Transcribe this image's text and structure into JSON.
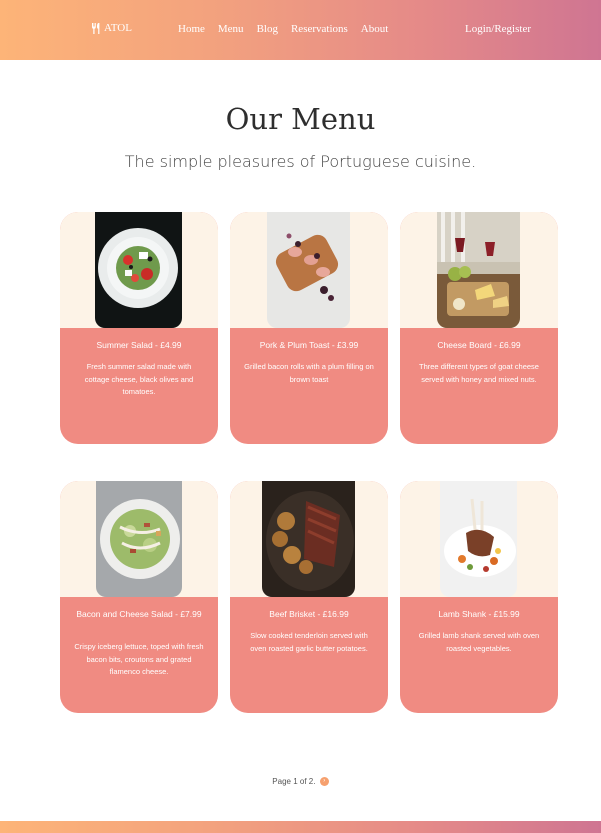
{
  "header": {
    "logo_text": "ATOL",
    "nav": [
      {
        "label": "Home"
      },
      {
        "label": "Menu"
      },
      {
        "label": "Blog"
      },
      {
        "label": "Reservations"
      },
      {
        "label": "About"
      }
    ],
    "login_label": "Login/Register"
  },
  "main": {
    "title": "Our Menu",
    "subtitle": "The simple pleasures of Portuguese cuisine."
  },
  "menu_items": [
    {
      "name": "Summer Salad - £4.99",
      "description": "Fresh summer salad made with cottage cheese, black olives and tomatoes."
    },
    {
      "name": "Pork & Plum Toast - £3.99",
      "description": "Grilled bacon rolls with a plum filling on brown toast"
    },
    {
      "name": "Cheese Board - £6.99",
      "description": "Three different types of goat cheese served with honey and mixed nuts."
    },
    {
      "name": "Bacon and Cheese Salad - £7.99",
      "description": "Crispy iceberg lettuce, toped with fresh bacon bits, croutons and grated flamenco cheese."
    },
    {
      "name": "Beef Brisket - £16.99",
      "description": "Slow cooked tenderloin served with oven roasted garlic butter potatoes."
    },
    {
      "name": "Lamb Shank - £15.99",
      "description": "Grilled lamb shank served with oven roasted vegetables."
    }
  ],
  "pagination": {
    "text": "Page 1 of 2.",
    "next_symbol": "›"
  },
  "colors": {
    "card": "#f08b82",
    "card_top": "#fdf3e7",
    "header_start": "#fdb478",
    "header_end": "#cf7592"
  }
}
